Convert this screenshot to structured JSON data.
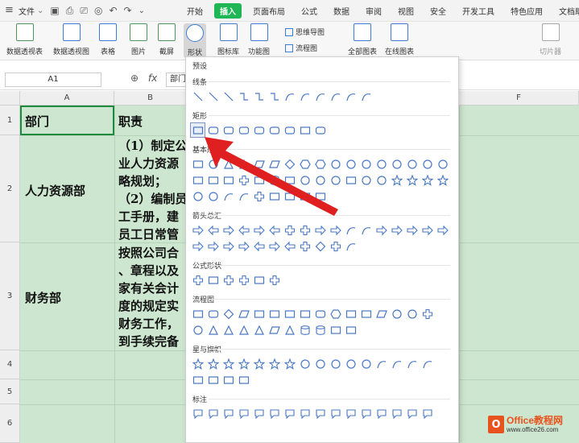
{
  "menubar": {
    "file_label": "文件",
    "tabs": [
      "开始",
      "插入",
      "页面布局",
      "公式",
      "数据",
      "审阅",
      "视图",
      "安全",
      "开发工具",
      "特色应用",
      "文档助"
    ],
    "active_tab": "插入"
  },
  "ribbon": {
    "pivot_table": "数据透视表",
    "pivot_chart": "数据透视图",
    "table": "表格",
    "picture": "图片",
    "screenshot": "截屏",
    "shapes": "形状",
    "icon_lib": "图标库",
    "function_chart": "功能图",
    "mindmap": "思维导图",
    "flowchart": "流程图",
    "all_charts": "全部图表",
    "online_chart": "在线图表",
    "slicer": "切片器"
  },
  "formula_bar": {
    "name_box": "A1",
    "fx": "fx",
    "value": "部门"
  },
  "grid": {
    "columns": [
      "A",
      "B",
      "F"
    ],
    "rows": [
      "1",
      "2",
      "3",
      "4",
      "5",
      "6"
    ],
    "a1": "部门",
    "b1": "职责",
    "a2": "人力资源部",
    "b2_lines": [
      "（1）制定公",
      "业人力资源",
      "略规划；",
      "（2）编制员",
      "工手册，建",
      "员工日常管"
    ],
    "a3": "财务部",
    "b3_lines": [
      "按照公司合",
      "、章程以及",
      "家有关会计",
      "度的规定实",
      "财务工作，",
      "到手续完备"
    ]
  },
  "shapes_menu": {
    "preset": "预设",
    "lines": "线条",
    "rectangles": "矩形",
    "basic": "基本形状",
    "arrows": "箭头总汇",
    "equation": "公式形状",
    "flowchart": "流程图",
    "stars": "星与旗帜",
    "callouts": "标注"
  },
  "watermark": {
    "logo_glyph": "O",
    "brand": "Office教程网",
    "url": "www.office26.com"
  },
  "colors": {
    "accent_green": "#1fb755",
    "sheet_fill": "#cde6cf",
    "arrow_red": "#e02020"
  }
}
